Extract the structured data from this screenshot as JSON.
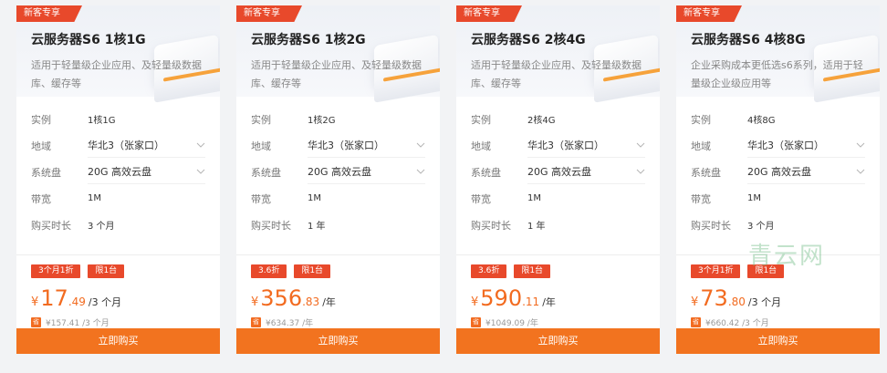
{
  "watermark": "青云网",
  "cards": [
    {
      "tag": "新客专享",
      "title": "云服务器S6 1核1G",
      "desc": "适用于轻量级企业应用、及轻量级数据库、缓存等",
      "labels": {
        "instance": "实例",
        "region": "地域",
        "disk": "系统盘",
        "bandwidth": "带宽",
        "duration": "购买时长"
      },
      "instance": "1核1G",
      "region": "华北3（张家口）",
      "disk": "20G 高效云盘",
      "bandwidth": "1M",
      "duration": "3 个月",
      "badge1": "3个月1折",
      "badge2": "限1台",
      "currency": "¥",
      "price_int": "17",
      "price_dec": ".49",
      "unit": "/3 个月",
      "sheng": "省",
      "original": "¥157.41 /3 个月",
      "buy": "立即购买"
    },
    {
      "tag": "新客专享",
      "title": "云服务器S6 1核2G",
      "desc": "适用于轻量级企业应用、及轻量级数据库、缓存等",
      "labels": {
        "instance": "实例",
        "region": "地域",
        "disk": "系统盘",
        "bandwidth": "带宽",
        "duration": "购买时长"
      },
      "instance": "1核2G",
      "region": "华北3（张家口）",
      "disk": "20G 高效云盘",
      "bandwidth": "1M",
      "duration": "1 年",
      "badge1": "3.6折",
      "badge2": "限1台",
      "currency": "¥",
      "price_int": "356",
      "price_dec": ".83",
      "unit": "/年",
      "sheng": "省",
      "original": "¥634.37 /年",
      "buy": "立即购买"
    },
    {
      "tag": "新客专享",
      "title": "云服务器S6 2核4G",
      "desc": "适用于轻量级企业应用、及轻量级数据库、缓存等",
      "labels": {
        "instance": "实例",
        "region": "地域",
        "disk": "系统盘",
        "bandwidth": "带宽",
        "duration": "购买时长"
      },
      "instance": "2核4G",
      "region": "华北3（张家口）",
      "disk": "20G 高效云盘",
      "bandwidth": "1M",
      "duration": "1 年",
      "badge1": "3.6折",
      "badge2": "限1台",
      "currency": "¥",
      "price_int": "590",
      "price_dec": ".11",
      "unit": "/年",
      "sheng": "省",
      "original": "¥1049.09 /年",
      "buy": "立即购买"
    },
    {
      "tag": "新客专享",
      "title": "云服务器S6 4核8G",
      "desc": "企业采购成本更低选s6系列，适用于轻量级企业级应用等",
      "labels": {
        "instance": "实例",
        "region": "地域",
        "disk": "系统盘",
        "bandwidth": "带宽",
        "duration": "购买时长"
      },
      "instance": "4核8G",
      "region": "华北3（张家口）",
      "disk": "20G 高效云盘",
      "bandwidth": "1M",
      "duration": "3 个月",
      "badge1": "3个月1折",
      "badge2": "限1台",
      "currency": "¥",
      "price_int": "73",
      "price_dec": ".80",
      "unit": "/3 个月",
      "sheng": "省",
      "original": "¥660.42 /3 个月",
      "buy": "立即购买"
    }
  ]
}
